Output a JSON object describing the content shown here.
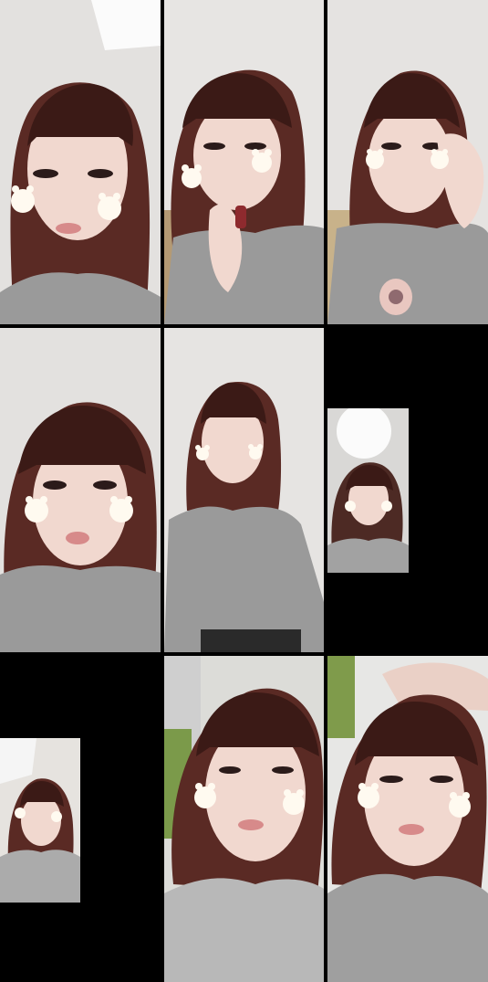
{
  "grid": {
    "rows": 3,
    "columns": 3,
    "background_color": "#000000",
    "cells": [
      {
        "id": "cell-1",
        "content": "photo",
        "scene": "indoor"
      },
      {
        "id": "cell-2",
        "content": "photo",
        "scene": "indoor"
      },
      {
        "id": "cell-3",
        "content": "photo",
        "scene": "indoor"
      },
      {
        "id": "cell-4",
        "content": "photo",
        "scene": "indoor"
      },
      {
        "id": "cell-5",
        "content": "photo",
        "scene": "indoor"
      },
      {
        "id": "cell-6",
        "content": "letterboxed-photo",
        "scene": "indoor"
      },
      {
        "id": "cell-7",
        "content": "letterboxed-photo",
        "scene": "outdoor"
      },
      {
        "id": "cell-8",
        "content": "photo",
        "scene": "outdoor"
      },
      {
        "id": "cell-9",
        "content": "photo",
        "scene": "outdoor"
      }
    ]
  },
  "colors": {
    "hair": "#5a2a24",
    "hair_dark": "#3b1a16",
    "skin": "#f1d8cf",
    "blush": "#f2b5b5",
    "shirt": "#9a9a9a",
    "wall": "#e7e5e3",
    "sticker": "#fffaf0"
  },
  "stickers": {
    "icon": "bear-sticker-icon"
  }
}
